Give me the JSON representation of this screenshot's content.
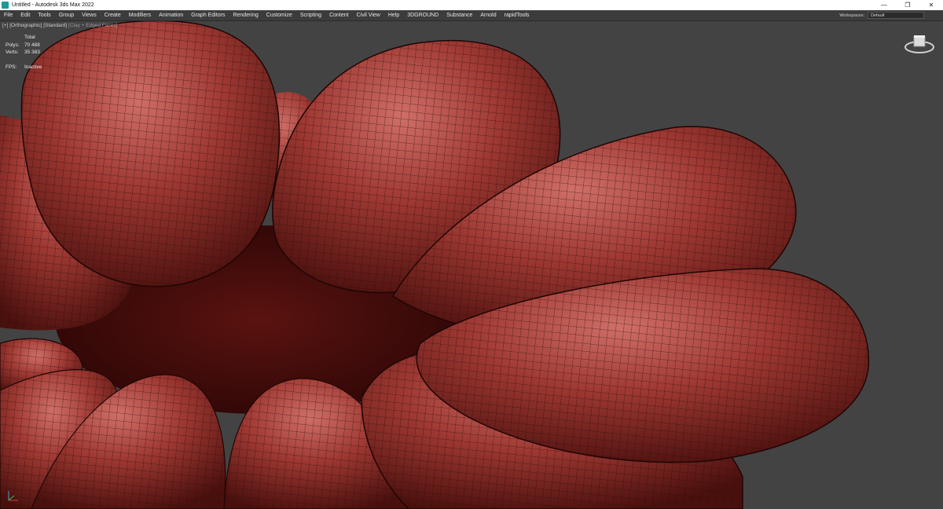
{
  "window": {
    "title": "Untitled - Autodesk 3ds Max 2022",
    "controls": [
      "—",
      "❐",
      "✕"
    ]
  },
  "menu": {
    "items": [
      "File",
      "Edit",
      "Tools",
      "Group",
      "Views",
      "Create",
      "Modifiers",
      "Animation",
      "Graph Editors",
      "Rendering",
      "Customize",
      "Scripting",
      "Content",
      "Civil View",
      "Help",
      "3DGROUND",
      "Substance",
      "Arnold",
      "rapidTools"
    ],
    "workspace_label": "Workspaces:",
    "workspace_value": "Default"
  },
  "viewport": {
    "label_plus": "[+]",
    "label_view": "[Orthographic]",
    "label_shading": "[Standard]",
    "label_style": "[Clay + Edged Faces]",
    "stats": {
      "total_label": "Total",
      "polys_label": "Polys:",
      "polys_value": "70 488",
      "verts_label": "Verts:",
      "verts_value": "35 383",
      "fps_label": "FPS:",
      "fps_value": "Inactive"
    },
    "mesh_color": "#9a3530",
    "background_color": "#434343",
    "icons": {
      "viewcube": "viewcube-icon",
      "axis": "axis-tripod-icon"
    }
  }
}
